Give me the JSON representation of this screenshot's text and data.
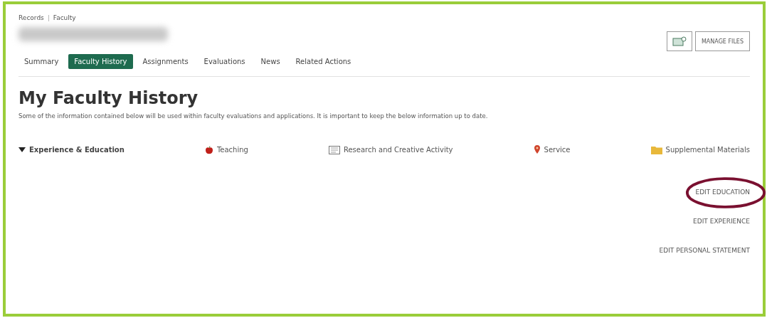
{
  "breadcrumb": [
    "Records",
    "Faculty"
  ],
  "tabs": [
    {
      "label": "Summary",
      "selected": false
    },
    {
      "label": "Faculty History",
      "selected": true
    },
    {
      "label": "Assignments",
      "selected": false
    },
    {
      "label": "Evaluations",
      "selected": false
    },
    {
      "label": "News",
      "selected": false
    },
    {
      "label": "Related Actions",
      "selected": false
    }
  ],
  "manage_files_button": "MANAGE FILES",
  "heading": "My Faculty History",
  "description": "Some of the information contained below will be used within faculty evaluations and applications. It is important to keep the below information up to date.",
  "sections": [
    {
      "label": "Experience & Education",
      "selected": true
    },
    {
      "label": "Teaching",
      "selected": false
    },
    {
      "label": "Research and Creative Activity",
      "selected": false
    },
    {
      "label": "Service",
      "selected": false
    },
    {
      "label": "Supplemental Materials",
      "selected": false
    }
  ],
  "actions": [
    {
      "label": "EDIT EDUCATION",
      "highlighted": true
    },
    {
      "label": "EDIT EXPERIENCE",
      "highlighted": false
    },
    {
      "label": "EDIT PERSONAL STATEMENT",
      "highlighted": false
    }
  ]
}
